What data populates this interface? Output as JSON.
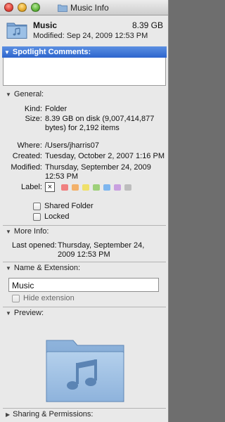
{
  "window": {
    "title": "Music Info",
    "icon": "folder-icon"
  },
  "header": {
    "name": "Music",
    "size": "8.39 GB",
    "modified": "Modified: Sep 24, 2009 12:53 PM"
  },
  "spotlight": {
    "label": "Spotlight Comments:",
    "value": ""
  },
  "general": {
    "label": "General:",
    "rows": [
      {
        "key": "Kind:",
        "value": "Folder"
      },
      {
        "key": "Size:",
        "value": "8.39 GB on disk (9,007,414,877 bytes) for 2,192 items"
      },
      {
        "key": "Where:",
        "value": "/Users/jharris07"
      },
      {
        "key": "Created:",
        "value": "Tuesday, October 2, 2007 1:16 PM"
      },
      {
        "key": "Modified:",
        "value": "Thursday, September 24, 2009 12:53 PM"
      }
    ],
    "label_key": "Label:",
    "label_none": "×",
    "label_colors": [
      "#f08080",
      "#f3b16a",
      "#efe06a",
      "#9ed07a",
      "#7eb6ef",
      "#c9a0e0",
      "#bdbdbd"
    ],
    "shared_folder": "Shared Folder",
    "locked": "Locked"
  },
  "more_info": {
    "label": "More Info:",
    "last_opened_key": "Last opened:",
    "last_opened_value": "Thursday, September 24, 2009 12:53 PM"
  },
  "name_extension": {
    "label": "Name & Extension:",
    "name_value": "Music",
    "hide_extension": "Hide extension"
  },
  "preview": {
    "label": "Preview:"
  },
  "sharing": {
    "label": "Sharing & Permissions:"
  }
}
